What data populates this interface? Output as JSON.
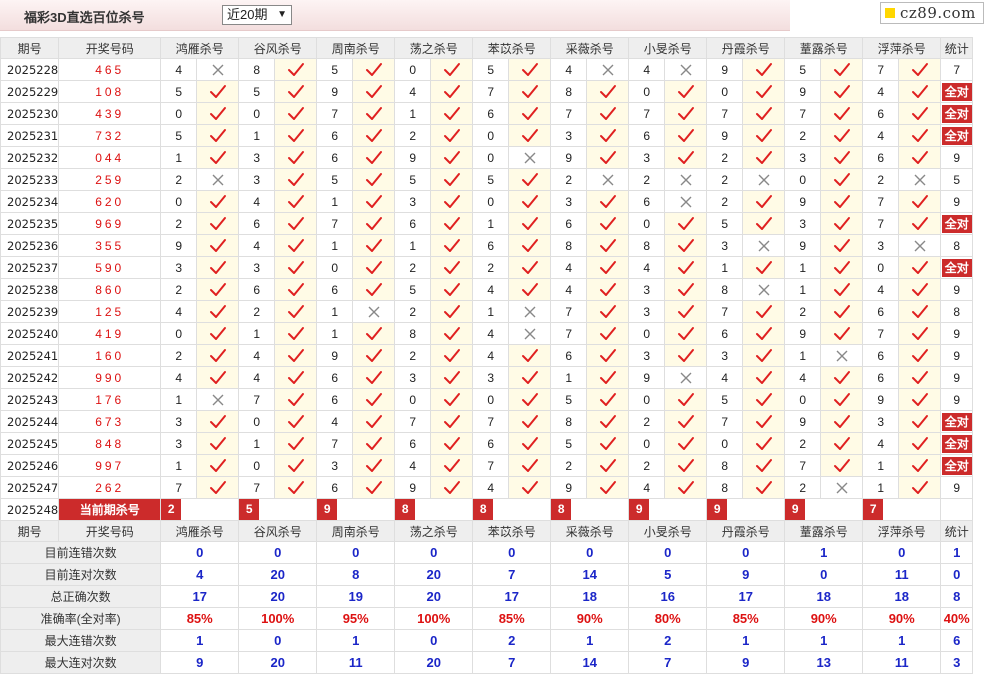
{
  "header": {
    "title": "福彩3D直选百位杀号",
    "period_select": "近20期",
    "logo": "cz89.com"
  },
  "columns": {
    "period": "期号",
    "draw": "开奖号码",
    "experts": [
      "鸿雁杀号",
      "谷风杀号",
      "周南杀号",
      "荡之杀号",
      "苯苡杀号",
      "采薇杀号",
      "小旻杀号",
      "丹霞杀号",
      "蕫露杀号",
      "浮萍杀号"
    ],
    "stat": "统计"
  },
  "rows": [
    {
      "period": "2025228",
      "draw": "465",
      "kills": [
        4,
        8,
        5,
        0,
        5,
        4,
        4,
        9,
        5,
        7
      ],
      "hits": [
        0,
        1,
        1,
        1,
        1,
        0,
        0,
        1,
        1,
        1
      ],
      "stat": "7"
    },
    {
      "period": "2025229",
      "draw": "108",
      "kills": [
        5,
        5,
        9,
        4,
        7,
        8,
        0,
        0,
        9,
        4
      ],
      "hits": [
        1,
        1,
        1,
        1,
        1,
        1,
        1,
        1,
        1,
        1
      ],
      "stat": "全对"
    },
    {
      "period": "2025230",
      "draw": "439",
      "kills": [
        0,
        0,
        7,
        1,
        6,
        7,
        7,
        7,
        7,
        6
      ],
      "hits": [
        1,
        1,
        1,
        1,
        1,
        1,
        1,
        1,
        1,
        1
      ],
      "stat": "全对"
    },
    {
      "period": "2025231",
      "draw": "732",
      "kills": [
        5,
        1,
        6,
        2,
        0,
        3,
        6,
        9,
        2,
        4
      ],
      "hits": [
        1,
        1,
        1,
        1,
        1,
        1,
        1,
        1,
        1,
        1
      ],
      "stat": "全对"
    },
    {
      "period": "2025232",
      "draw": "044",
      "kills": [
        1,
        3,
        6,
        9,
        0,
        9,
        3,
        2,
        3,
        6
      ],
      "hits": [
        1,
        1,
        1,
        1,
        0,
        1,
        1,
        1,
        1,
        1
      ],
      "stat": "9"
    },
    {
      "period": "2025233",
      "draw": "259",
      "kills": [
        2,
        3,
        5,
        5,
        5,
        2,
        2,
        2,
        0,
        2
      ],
      "hits": [
        0,
        1,
        1,
        1,
        1,
        0,
        0,
        0,
        1,
        0
      ],
      "stat": "5"
    },
    {
      "period": "2025234",
      "draw": "620",
      "kills": [
        0,
        4,
        1,
        3,
        0,
        3,
        6,
        2,
        9,
        7
      ],
      "hits": [
        1,
        1,
        1,
        1,
        1,
        1,
        0,
        1,
        1,
        1
      ],
      "stat": "9"
    },
    {
      "period": "2025235",
      "draw": "969",
      "kills": [
        2,
        6,
        7,
        6,
        1,
        6,
        0,
        5,
        3,
        7
      ],
      "hits": [
        1,
        1,
        1,
        1,
        1,
        1,
        1,
        1,
        1,
        1
      ],
      "stat": "全对"
    },
    {
      "period": "2025236",
      "draw": "355",
      "kills": [
        9,
        4,
        1,
        1,
        6,
        8,
        8,
        3,
        9,
        3
      ],
      "hits": [
        1,
        1,
        1,
        1,
        1,
        1,
        1,
        0,
        1,
        0
      ],
      "stat": "8"
    },
    {
      "period": "2025237",
      "draw": "590",
      "kills": [
        3,
        3,
        0,
        2,
        2,
        4,
        4,
        1,
        1,
        0
      ],
      "hits": [
        1,
        1,
        1,
        1,
        1,
        1,
        1,
        1,
        1,
        1
      ],
      "stat": "全对"
    },
    {
      "period": "2025238",
      "draw": "860",
      "kills": [
        2,
        6,
        6,
        5,
        4,
        4,
        3,
        8,
        1,
        4
      ],
      "hits": [
        1,
        1,
        1,
        1,
        1,
        1,
        1,
        0,
        1,
        1
      ],
      "stat": "9"
    },
    {
      "period": "2025239",
      "draw": "125",
      "kills": [
        4,
        2,
        1,
        2,
        1,
        7,
        3,
        7,
        2,
        6
      ],
      "hits": [
        1,
        1,
        0,
        1,
        0,
        1,
        1,
        1,
        1,
        1
      ],
      "stat": "8"
    },
    {
      "period": "2025240",
      "draw": "419",
      "kills": [
        0,
        1,
        1,
        8,
        4,
        7,
        0,
        6,
        9,
        7
      ],
      "hits": [
        1,
        1,
        1,
        1,
        0,
        1,
        1,
        1,
        1,
        1
      ],
      "stat": "9"
    },
    {
      "period": "2025241",
      "draw": "160",
      "kills": [
        2,
        4,
        9,
        2,
        4,
        6,
        3,
        3,
        1,
        6
      ],
      "hits": [
        1,
        1,
        1,
        1,
        1,
        1,
        1,
        1,
        0,
        1
      ],
      "stat": "9"
    },
    {
      "period": "2025242",
      "draw": "990",
      "kills": [
        4,
        4,
        6,
        3,
        3,
        1,
        9,
        4,
        4,
        6
      ],
      "hits": [
        1,
        1,
        1,
        1,
        1,
        1,
        0,
        1,
        1,
        1
      ],
      "stat": "9"
    },
    {
      "period": "2025243",
      "draw": "176",
      "kills": [
        1,
        7,
        6,
        0,
        0,
        5,
        0,
        5,
        0,
        9
      ],
      "hits": [
        0,
        1,
        1,
        1,
        1,
        1,
        1,
        1,
        1,
        1
      ],
      "stat": "9"
    },
    {
      "period": "2025244",
      "draw": "673",
      "kills": [
        3,
        0,
        4,
        7,
        7,
        8,
        2,
        7,
        9,
        3
      ],
      "hits": [
        1,
        1,
        1,
        1,
        1,
        1,
        1,
        1,
        1,
        1
      ],
      "stat": "全对"
    },
    {
      "period": "2025245",
      "draw": "848",
      "kills": [
        3,
        1,
        7,
        6,
        6,
        5,
        0,
        0,
        2,
        4
      ],
      "hits": [
        1,
        1,
        1,
        1,
        1,
        1,
        1,
        1,
        1,
        1
      ],
      "stat": "全对"
    },
    {
      "period": "2025246",
      "draw": "997",
      "kills": [
        1,
        0,
        3,
        4,
        7,
        2,
        2,
        8,
        7,
        1
      ],
      "hits": [
        1,
        1,
        1,
        1,
        1,
        1,
        1,
        1,
        1,
        1
      ],
      "stat": "全对"
    },
    {
      "period": "2025247",
      "draw": "262",
      "kills": [
        7,
        7,
        6,
        9,
        4,
        9,
        4,
        8,
        2,
        1
      ],
      "hits": [
        1,
        1,
        1,
        1,
        1,
        1,
        1,
        1,
        0,
        1
      ],
      "stat": "9"
    }
  ],
  "current": {
    "period": "2025248",
    "label": "当前期杀号",
    "kills": [
      "2",
      "5",
      "9",
      "8",
      "8",
      "8",
      "9",
      "9",
      "9",
      "7"
    ]
  },
  "summary": [
    {
      "label": "目前连错次数",
      "values": [
        "0",
        "0",
        "0",
        "0",
        "0",
        "0",
        "0",
        "0",
        "1",
        "0"
      ],
      "stat": "1",
      "red": false
    },
    {
      "label": "目前连对次数",
      "values": [
        "4",
        "20",
        "8",
        "20",
        "7",
        "14",
        "5",
        "9",
        "0",
        "11"
      ],
      "stat": "0",
      "red": false
    },
    {
      "label": "总正确次数",
      "values": [
        "17",
        "20",
        "19",
        "20",
        "17",
        "18",
        "16",
        "17",
        "18",
        "18"
      ],
      "stat": "8",
      "red": false
    },
    {
      "label": "准确率(全对率)",
      "values": [
        "85%",
        "100%",
        "95%",
        "100%",
        "85%",
        "90%",
        "80%",
        "85%",
        "90%",
        "90%"
      ],
      "stat": "40%",
      "red": true
    },
    {
      "label": "最大连错次数",
      "values": [
        "1",
        "0",
        "1",
        "0",
        "2",
        "1",
        "2",
        "1",
        "1",
        "1"
      ],
      "stat": "6",
      "red": false
    },
    {
      "label": "最大连对次数",
      "values": [
        "9",
        "20",
        "11",
        "20",
        "7",
        "14",
        "7",
        "9",
        "13",
        "11"
      ],
      "stat": "3",
      "red": false
    }
  ],
  "colors": {
    "hit": "#e02020",
    "miss": "#888888",
    "accent": "#cc2b2b",
    "summary_blue": "#1b26c8"
  }
}
